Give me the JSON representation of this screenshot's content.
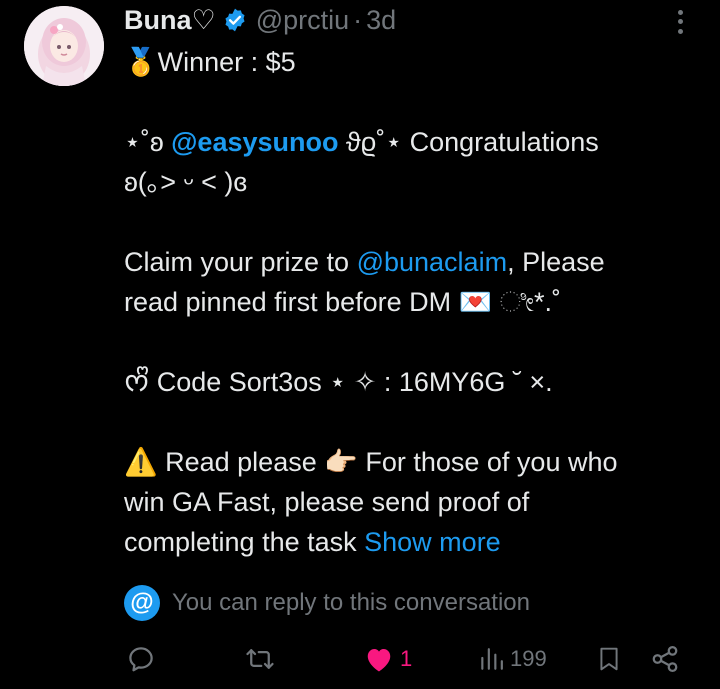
{
  "author": {
    "display_name": "Buna♡",
    "handle": "@prctiu",
    "separator": "·",
    "time": "3d",
    "verified_color": "#1d9bf0"
  },
  "tweet": {
    "line_winner": "🥇Winner : $5",
    "congrats_prefix": "⋆˚ʚ ",
    "mention_1": "@easysunoo",
    "congrats_suffix": " ϑϱ˚⋆ Congratulations",
    "kaomoji": "ʚ(｡˃ ᵕ ˂ )ɞ",
    "claim_prefix": "Claim your prize to ",
    "mention_2": "@bunaclaim",
    "claim_suffix": ", Please",
    "claim_line2": "read pinned first before DM 💌 ೀ*.˚",
    "code_line": "ᰔᩚ Code Sort3os ⋆ ✧ : 16MY6G ˘  ×.",
    "read_prefix": "⚠️ Read please 👉🏻 For those of you who",
    "read_line2": "win GA Fast, please send proof of",
    "read_line3": "completing the task ",
    "show_more": "Show more"
  },
  "reply_note": {
    "badge": "@",
    "text": "You can reply to this conversation"
  },
  "actions": {
    "reply_icon": "reply-icon",
    "retweet_icon": "retweet-icon",
    "like_icon": "heart-icon",
    "like_count": "1",
    "views_icon": "views-icon",
    "views_count": "199",
    "bookmark_icon": "bookmark-icon",
    "share_icon": "share-icon",
    "like_color": "#f91880",
    "muted_color": "#71767b",
    "link_color": "#1d9bf0"
  }
}
